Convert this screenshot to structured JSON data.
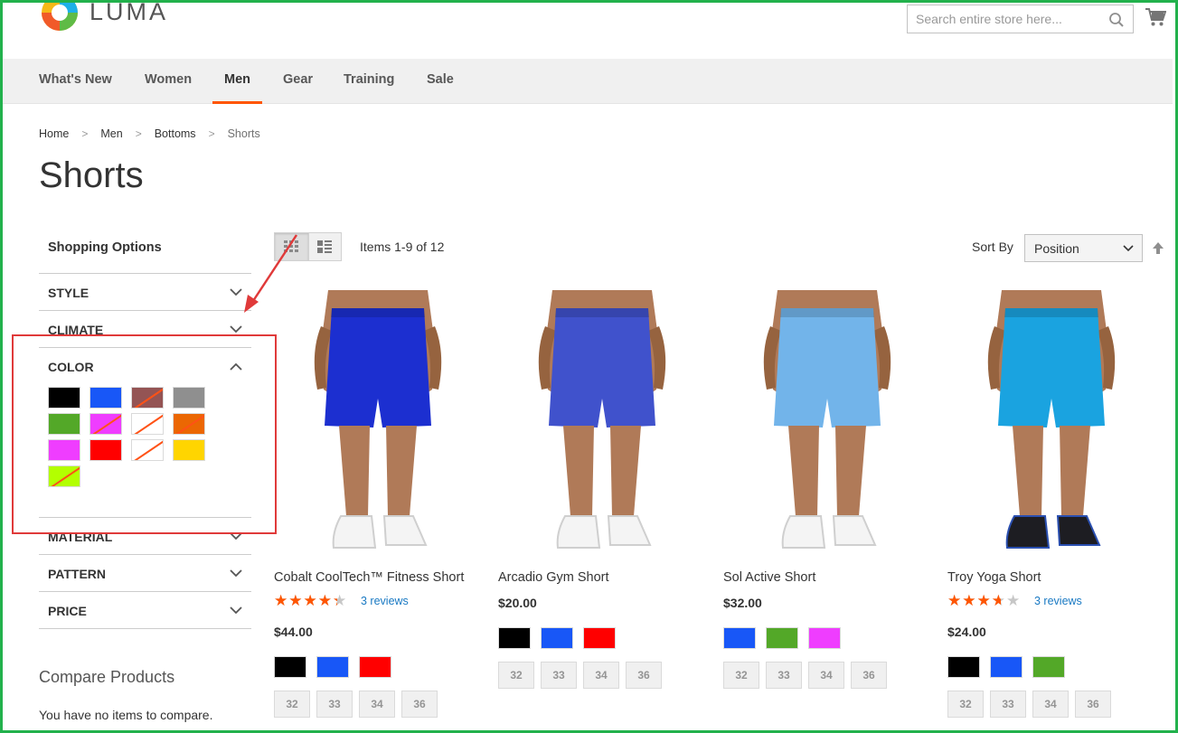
{
  "header": {
    "logo_text": "LUMA",
    "search_placeholder": "Search entire store here..."
  },
  "nav": {
    "items": [
      "What's New",
      "Women",
      "Men",
      "Gear",
      "Training",
      "Sale"
    ],
    "active": "Men"
  },
  "breadcrumb": [
    "Home",
    "Men",
    "Bottoms",
    "Shorts"
  ],
  "page_title": "Shorts",
  "sidebar": {
    "title": "Shopping Options",
    "filters": [
      "STYLE",
      "CLIMATE",
      "COLOR",
      "MATERIAL",
      "PATTERN",
      "PRICE"
    ],
    "color_swatches": [
      {
        "color": "#000000",
        "available": true
      },
      {
        "color": "#1857f7",
        "available": true
      },
      {
        "color": "#945454",
        "available": false
      },
      {
        "color": "#8f8f8f",
        "available": true
      },
      {
        "color": "#53a828",
        "available": true
      },
      {
        "color": "#ef3dff",
        "available": false
      },
      {
        "color": "#ffffff",
        "available": false
      },
      {
        "color": "#eb6703",
        "available": false
      },
      {
        "color": "#ef3dff",
        "available": true
      },
      {
        "color": "#ff0000",
        "available": true
      },
      {
        "color": "#ffffff",
        "available": false
      },
      {
        "color": "#ffd500",
        "available": true
      },
      {
        "color": "#b3ff00",
        "available": false
      }
    ],
    "compare_title": "Compare Products",
    "compare_text": "You have no items to compare."
  },
  "toolbar": {
    "items_count": "Items 1-9 of 12",
    "sort_label": "Sort By",
    "sort_value": "Position"
  },
  "products": [
    {
      "name": "Cobalt CoolTech™ Fitness Short",
      "rating": 0.8,
      "reviews": "3 reviews",
      "price": "$44.00",
      "colors": [
        "#000000",
        "#1857f7",
        "#ff0000"
      ],
      "sizes": [
        "32",
        "33",
        "34",
        "36"
      ],
      "short_color": "#1c2fd0",
      "shoe": "white"
    },
    {
      "name": "Arcadio Gym Short",
      "rating": null,
      "reviews": "",
      "price": "$20.00",
      "colors": [
        "#000000",
        "#1857f7",
        "#ff0000"
      ],
      "sizes": [
        "32",
        "33",
        "34",
        "36"
      ],
      "short_color": "#4052cc",
      "shoe": "white"
    },
    {
      "name": "Sol Active Short",
      "rating": null,
      "reviews": "",
      "price": "$32.00",
      "colors": [
        "#1857f7",
        "#53a828",
        "#ef3dff"
      ],
      "sizes": [
        "32",
        "33",
        "34",
        "36"
      ],
      "short_color": "#72b4ea",
      "shoe": "white"
    },
    {
      "name": "Troy Yoga Short",
      "rating": 0.67,
      "reviews": "3 reviews",
      "price": "$24.00",
      "colors": [
        "#000000",
        "#1857f7",
        "#53a828"
      ],
      "sizes": [
        "32",
        "33",
        "34",
        "36"
      ],
      "short_color": "#1aa3e0",
      "shoe": "black"
    }
  ]
}
